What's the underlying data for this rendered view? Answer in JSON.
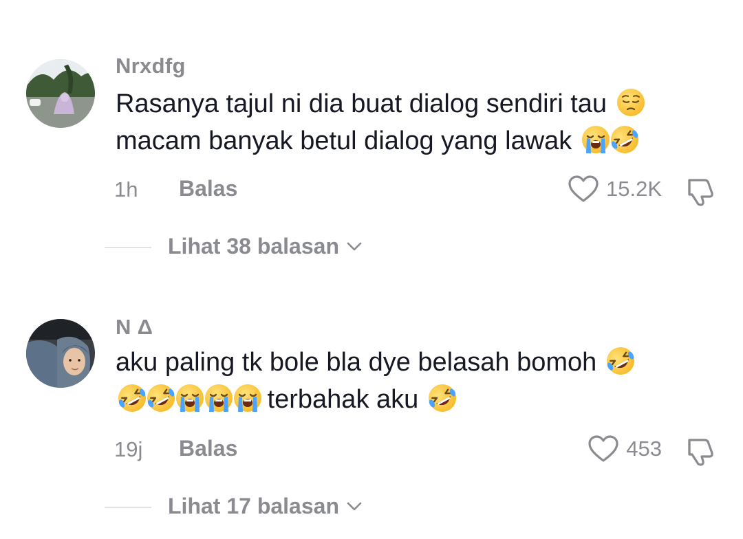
{
  "comments": [
    {
      "username": "Nrxdfg",
      "text_line1": "Rasanya tajul ni dia buat dialog sendiri tau ",
      "text_line2": "macam banyak betul dialog yang lawak ",
      "time": "1h",
      "reply_label": "Balas",
      "likes": "15.2K",
      "view_replies": "Lihat 38 balasan",
      "emojis_line1": [
        "pensive-face-emoji"
      ],
      "emojis_line2": [
        "loudly-crying-face-emoji",
        "rolling-on-floor-laughing-emoji"
      ]
    },
    {
      "username": "N Δ",
      "text_line1": "aku paling tk bole bla dye belasah bomoh ",
      "text_line2_after": " terbahak aku ",
      "time": "19j",
      "reply_label": "Balas",
      "likes": "453",
      "view_replies": "Lihat 17 balasan",
      "emojis_line1": [
        "rolling-on-floor-laughing-emoji"
      ],
      "emojis_line2_before": [
        "rolling-on-floor-laughing-emoji",
        "rolling-on-floor-laughing-emoji",
        "loudly-crying-face-emoji",
        "loudly-crying-face-emoji",
        "loudly-crying-face-emoji"
      ],
      "emojis_line2_after": [
        "rolling-on-floor-laughing-emoji"
      ]
    }
  ],
  "colors": {
    "text": "#161823",
    "secondary": "#8a8b91",
    "emoji_yellow": "#ffc83d",
    "tear_blue": "#4aa3ff"
  }
}
